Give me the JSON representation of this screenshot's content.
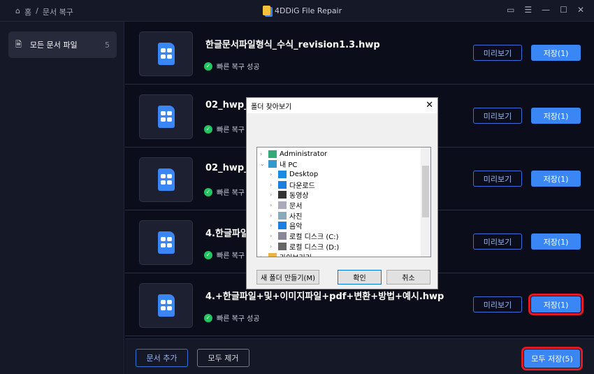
{
  "titlebar": {
    "home": "홈",
    "separator": "/",
    "crumb": "문서 복구",
    "app_title": "4DDiG File Repair"
  },
  "sidebar": {
    "item_label": "모든 문서 파일",
    "item_count": "5"
  },
  "files": [
    {
      "name": "한글문서파일형식_수식_revision1.3.hwp",
      "status": "빠른 복구 성공",
      "preview": "미리보기",
      "save": "저장(1)"
    },
    {
      "name": "02_hwp_s",
      "status": "빠른 복구",
      "preview": "미리보기",
      "save": "저장(1)"
    },
    {
      "name": "02_hwp_s",
      "status": "빠른 복구",
      "preview": "미리보기",
      "save": "저장(1)"
    },
    {
      "name": "4.한글파일",
      "status": "빠른 복구",
      "preview": "미리보기",
      "save": "저장(1)"
    },
    {
      "name": "4.+한글파일+및+이미지파일+pdf+변환+방법+예시.hwp",
      "status": "빠른 복구 성공",
      "preview": "미리보기",
      "save": "저장(1)"
    }
  ],
  "footer": {
    "add": "문서 추가",
    "remove_all": "모두 제거",
    "save_all": "모두 저장(5)"
  },
  "dialog": {
    "title": "폴더 찾아보기",
    "tree": [
      "Administrator",
      "내 PC",
      "Desktop",
      "다운로드",
      "동영상",
      "문서",
      "사진",
      "음악",
      "로컬 디스크 (C:)",
      "로컬 디스크 (D:)",
      "라이브러리"
    ],
    "new_folder": "새 폴더 만들기(M)",
    "ok": "확인",
    "cancel": "취소"
  }
}
